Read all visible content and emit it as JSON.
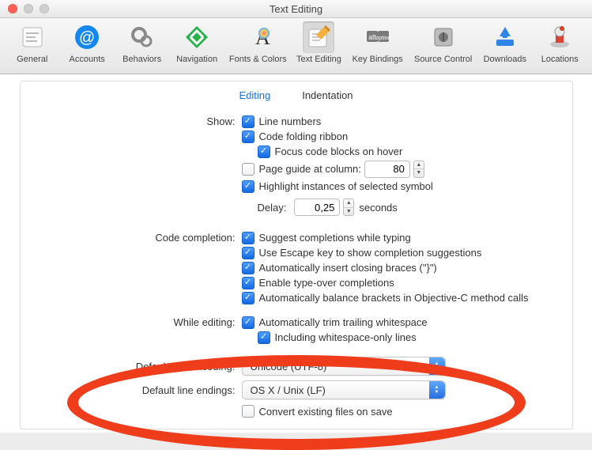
{
  "window": {
    "title": "Text Editing",
    "trafficColors": {
      "close": "#ff5f57",
      "min": "#cfcfcf",
      "max": "#cfcfcf"
    }
  },
  "toolbar": [
    {
      "key": "general",
      "label": "General",
      "selected": false
    },
    {
      "key": "accounts",
      "label": "Accounts",
      "selected": false
    },
    {
      "key": "behaviors",
      "label": "Behaviors",
      "selected": false
    },
    {
      "key": "navigation",
      "label": "Navigation",
      "selected": false
    },
    {
      "key": "fonts-colors",
      "label": "Fonts & Colors",
      "selected": false
    },
    {
      "key": "text-editing",
      "label": "Text Editing",
      "selected": true
    },
    {
      "key": "key-bindings",
      "label": "Key Bindings",
      "selected": false
    },
    {
      "key": "source-control",
      "label": "Source Control",
      "selected": false
    },
    {
      "key": "downloads",
      "label": "Downloads",
      "selected": false
    },
    {
      "key": "locations",
      "label": "Locations",
      "selected": false
    }
  ],
  "subtabs": {
    "editing": "Editing",
    "indentation": "Indentation",
    "active": "editing"
  },
  "labels": {
    "show": "Show:",
    "codeCompletion": "Code completion:",
    "whileEditing": "While editing:",
    "defaultEncoding": "Default text encoding:",
    "defaultLineEndings": "Default line endings:",
    "delay": "Delay:",
    "seconds": "seconds"
  },
  "show": {
    "lineNumbers": {
      "label": "Line numbers",
      "checked": true
    },
    "codeFolding": {
      "label": "Code folding ribbon",
      "checked": true
    },
    "focusBlocks": {
      "label": "Focus code blocks on hover",
      "checked": true
    },
    "pageGuide": {
      "label": "Page guide at column:",
      "checked": false,
      "value": "80"
    },
    "highlight": {
      "label": "Highlight instances of selected symbol",
      "checked": true
    },
    "delayValue": "0,25"
  },
  "completion": {
    "suggest": {
      "label": "Suggest completions while typing",
      "checked": true
    },
    "escape": {
      "label": "Use Escape key to show completion suggestions",
      "checked": true
    },
    "braces": {
      "label": "Automatically insert closing braces (\"}\")",
      "checked": true
    },
    "typeover": {
      "label": "Enable type-over completions",
      "checked": true
    },
    "balance": {
      "label": "Automatically balance brackets in Objective-C method calls",
      "checked": true
    }
  },
  "editing": {
    "trim": {
      "label": "Automatically trim trailing whitespace",
      "checked": true
    },
    "wsOnly": {
      "label": "Including whitespace-only lines",
      "checked": true
    }
  },
  "encodingSelect": {
    "value": "Unicode (UTF-8)"
  },
  "lineEndingsSelect": {
    "value": "OS X / Unix (LF)"
  },
  "convertFiles": {
    "label": "Convert existing files on save",
    "checked": false
  }
}
